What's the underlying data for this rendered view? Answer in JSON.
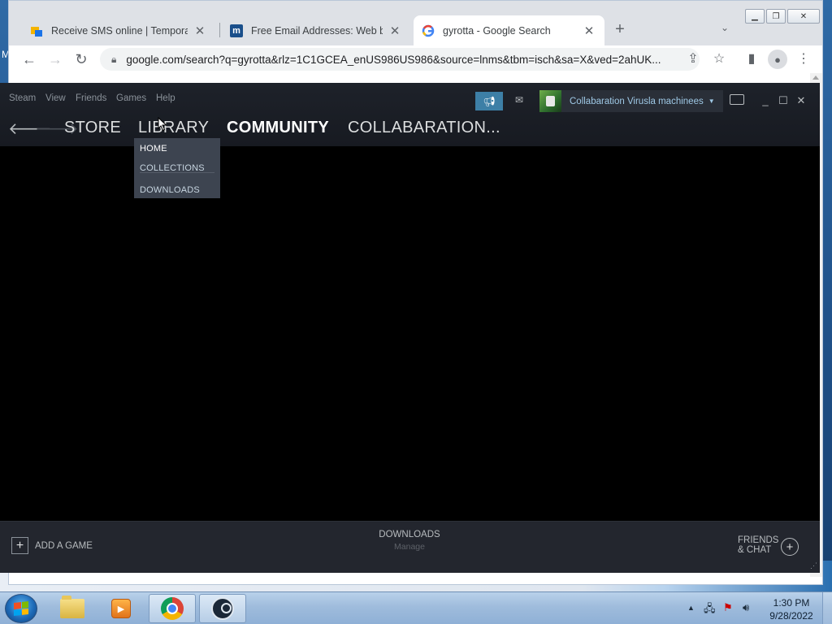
{
  "desktop": {
    "left_edge_text": "M"
  },
  "browser": {
    "tabs": [
      {
        "icon": "sms-site-icon",
        "title": "Receive SMS online | Temporary",
        "active": false
      },
      {
        "icon": "mailbox-site-icon",
        "title": "Free Email Addresses: Web base",
        "active": false
      },
      {
        "icon": "google-icon",
        "title": "gyrotta - Google Search",
        "active": true
      }
    ],
    "close_glyph": "✕",
    "new_tab_glyph": "+",
    "url": "google.com/search?q=gyrotta&rlz=1C1GCEA_enUS986US986&source=lnms&tbm=isch&sa=X&ved=2ahUK..."
  },
  "steam": {
    "menu": [
      "Steam",
      "View",
      "Friends",
      "Games",
      "Help"
    ],
    "username": "Collabaration Virusla machinees",
    "nav": {
      "store": "STORE",
      "library": "LIBRARY",
      "community": "COMMUNITY",
      "profile": "COLLABARATION..."
    },
    "library_dropdown": [
      "HOME",
      "COLLECTIONS",
      "DOWNLOADS"
    ],
    "bottom": {
      "add_game": "ADD A GAME",
      "downloads": "DOWNLOADS",
      "downloads_sub": "Manage",
      "friends_line1": "FRIENDS",
      "friends_line2": "& CHAT"
    }
  },
  "taskbar": {
    "time": "1:30 PM",
    "date": "9/28/2022",
    "apps": [
      "file-explorer",
      "media-player",
      "google-chrome",
      "steam"
    ]
  }
}
